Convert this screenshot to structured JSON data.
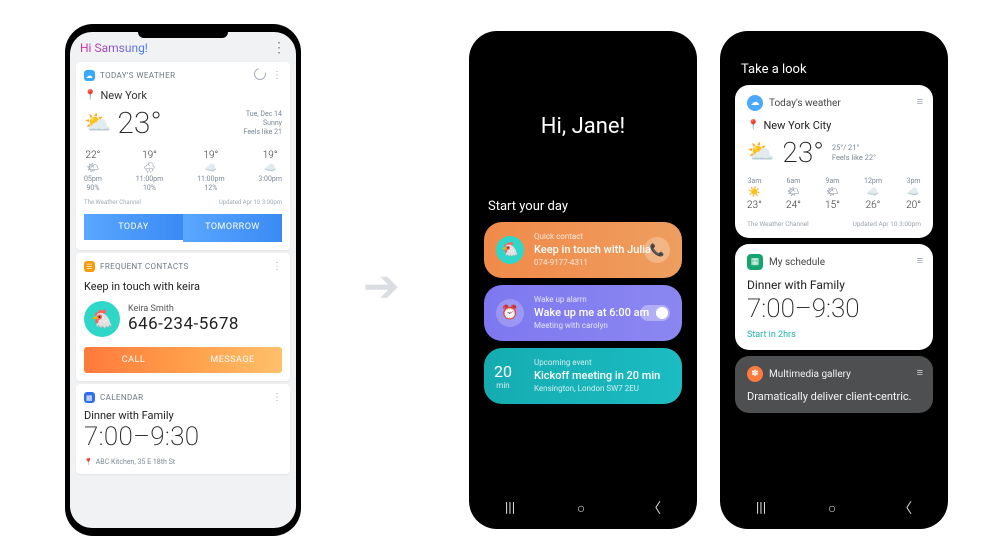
{
  "old_ui": {
    "greeting": "Hi Samsung!",
    "weather": {
      "header": "TODAY'S WEATHER",
      "city": "New York",
      "temp": "23°",
      "date": "Tue, Dec 14",
      "cond": "Sunny",
      "feels": "Feels like 21",
      "hourly": [
        {
          "temp": "22°",
          "icon": "🌤",
          "time": "05pm",
          "pct": "90%"
        },
        {
          "temp": "19°",
          "icon": "🌧",
          "time": "11:00pm",
          "pct": "10%"
        },
        {
          "temp": "19°",
          "icon": "☁️",
          "time": "11:00pm",
          "pct": "12%"
        },
        {
          "temp": "19°",
          "icon": "☁️",
          "time": "3:00pm",
          "pct": ""
        }
      ],
      "source": "The Weather Channel",
      "updated": "Updated Apr 10  3:00pm",
      "tabs": {
        "today": "TODAY",
        "tomorrow": "TOMORROW"
      }
    },
    "contacts": {
      "header": "FREQUENT CONTACTS",
      "title": "Keep in touch with keira",
      "name": "Keira Smith",
      "number": "646-234-5678",
      "call": "CALL",
      "message": "MESSAGE"
    },
    "calendar": {
      "header": "CALENDAR",
      "title": "Dinner with Family",
      "time": "7:00–9:30",
      "location": "ABC Kitchen, 35 E 18th St"
    }
  },
  "new_home": {
    "greeting": "Hi, Jane!",
    "section": "Start your day",
    "cards": {
      "contact": {
        "sub": "Quick contact",
        "main": "Keep in touch with Julia",
        "meta": "074-9177-4311"
      },
      "alarm": {
        "sub": "Wake up alarm",
        "main": "Wake up me at 6:00 am",
        "meta": "Meeting with carolyn"
      },
      "event": {
        "num": "20",
        "unit": "min",
        "sub": "Upcoming event",
        "main": "Kickoff meeting in 20 min",
        "meta": "Kensington, London SW7 2EU"
      }
    }
  },
  "new_panel": {
    "title": "Take a look",
    "weather": {
      "header": "Today's weather",
      "city": "New York City",
      "temp": "23°",
      "hilo": "25°/ 21°",
      "feels": "Feels like 22°",
      "hourly": [
        {
          "time": "3am",
          "icon": "☀️",
          "temp": "23°"
        },
        {
          "time": "6am",
          "icon": "🌤",
          "temp": "24°"
        },
        {
          "time": "9am",
          "icon": "🌤",
          "temp": "15°"
        },
        {
          "time": "12pm",
          "icon": "☁️",
          "temp": "26°"
        },
        {
          "time": "3pm",
          "icon": "☁️",
          "temp": "20°"
        }
      ],
      "source": "The Weather Channel",
      "updated": "Updated Apr 10  3:00pm"
    },
    "schedule": {
      "header": "My schedule",
      "title": "Dinner with Family",
      "time": "7:00–9:30",
      "start": "Start in 2hrs"
    },
    "gallery": {
      "header": "Multimedia gallery",
      "line": "Dramatically deliver client-centric."
    }
  }
}
